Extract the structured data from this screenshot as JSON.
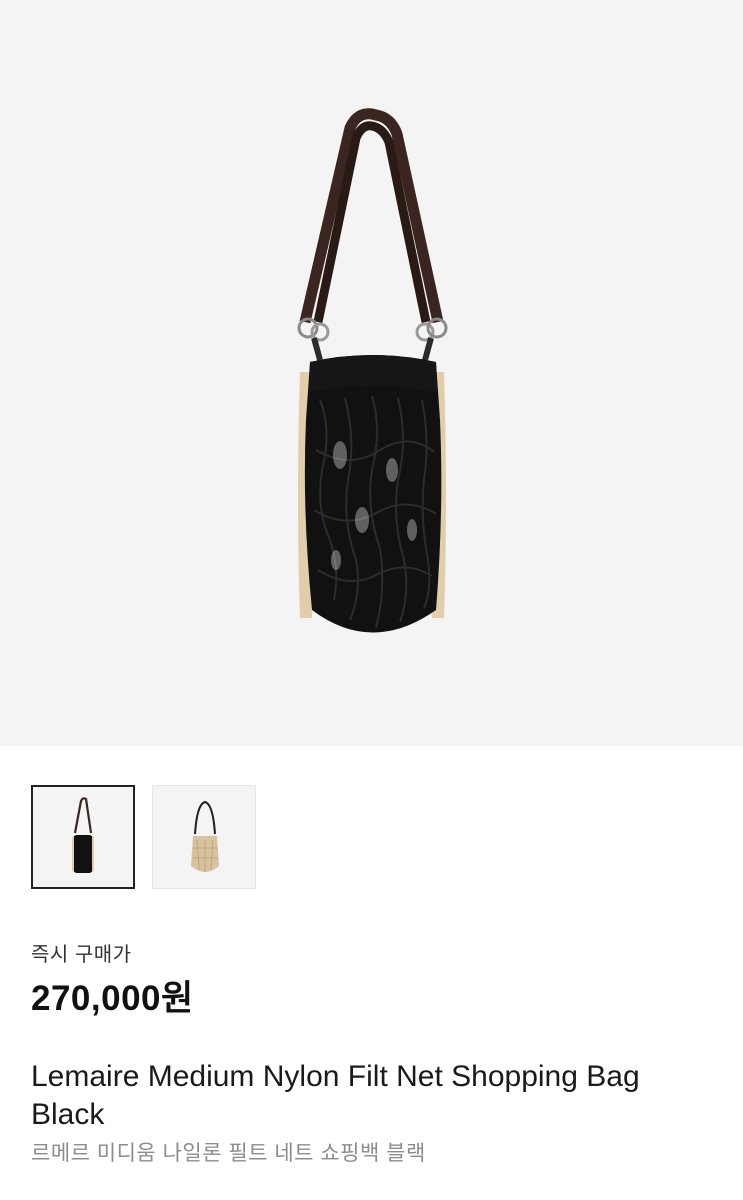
{
  "product": {
    "images": [
      {
        "name": "black-bag-front",
        "color": "#111111"
      },
      {
        "name": "beige-bag-front",
        "color": "#d8c3a0"
      }
    ],
    "selected_image_index": 0,
    "price_label": "즉시 구매가",
    "price": "270,000원",
    "title": "Lemaire Medium Nylon Filt Net Shopping Bag Black",
    "subtitle": "르메르 미디움 나일론 필트 네트 쇼핑백 블랙"
  },
  "colors": {
    "hero_bg": "#f4f4f4",
    "strap": "#3b2520",
    "bag_black": "#111111",
    "trim_beige": "#e1cda9",
    "subtitle_gray": "#8c8c8c"
  }
}
